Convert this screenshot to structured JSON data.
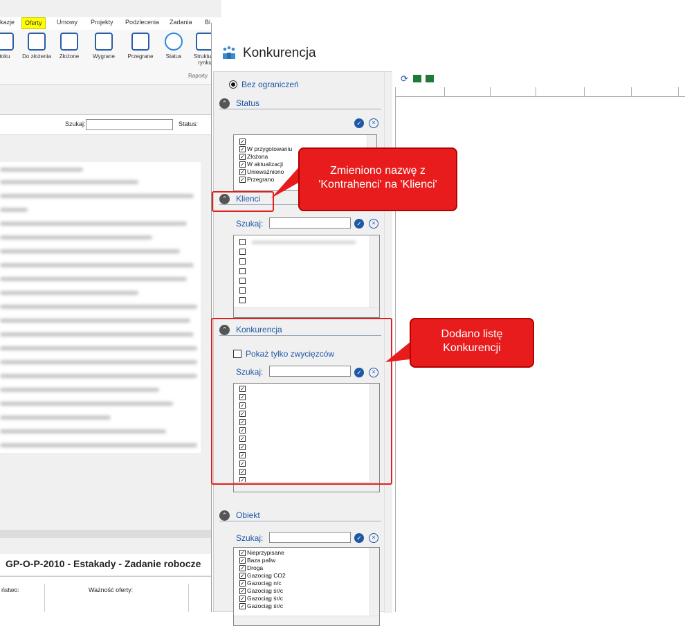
{
  "bg": {
    "menu": [
      "kazje",
      "Oferty",
      "Umowy",
      "Projekty",
      "Podzlecenia",
      "Zadania",
      "Bi"
    ],
    "ribbon": [
      "toku",
      "Do złożenia",
      "Złożone",
      "Wygrane",
      "Przegrane",
      "Status",
      "Struktura rynku"
    ],
    "ribbon_group": "Raporty",
    "search_label": "Szukaj:",
    "status_label": "Status:",
    "bottom_title": "GP-O-P-2010 - Estakady - Zadanie robocze",
    "field1": "ństwo:",
    "field2": "Ważność oferty:"
  },
  "dialog": {
    "title": "Konkurencja",
    "radio_label": "Bez ograniczeń",
    "status": {
      "label": "Status",
      "items": [
        "",
        "W przygotowaniu",
        "Złożona",
        "W aktualizacji",
        "Unieważniono",
        "Przegrano"
      ]
    },
    "klienci": {
      "label": "Klienci",
      "search_label": "Szukaj:"
    },
    "konkurencja": {
      "label": "Konkurencja",
      "only_winners": "Pokaż tylko zwycięzców",
      "search_label": "Szukaj:"
    },
    "obiekt": {
      "label": "Obiekt",
      "search_label": "Szukaj:",
      "items": [
        "Nieprzypisane",
        "Baza paliw",
        "Droga",
        "Gazociąg CO2",
        "Gazociąg n/c",
        "Gazociąg śr/c",
        "Gazociąg śr/c",
        "Gazociąg śr/c"
      ]
    }
  },
  "callouts": {
    "klienci_note": "Zmieniono nazwę z 'Kontrahenci' na 'Klienci'",
    "konkurencja_note": "Dodano listę Konkurencji"
  }
}
